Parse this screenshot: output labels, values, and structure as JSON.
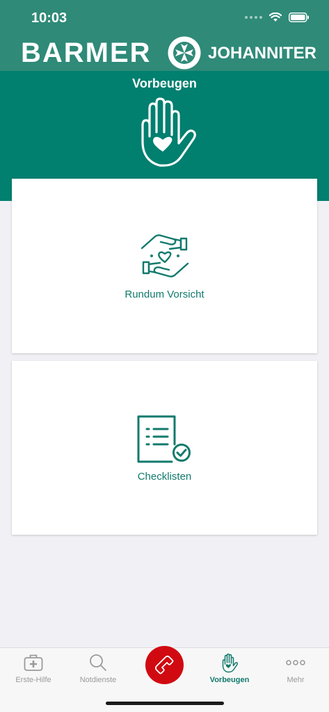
{
  "status_bar": {
    "time": "10:03"
  },
  "header": {
    "brand_left": "BARMER",
    "brand_right": "JOHANNITER",
    "emblem": "johanniter-cross-emblem",
    "page_title": "Vorbeugen",
    "hero_icon": "raised-hand-heart-icon"
  },
  "cards": [
    {
      "label": "Rundum Vorsicht",
      "icon": "hands-heart-icon"
    },
    {
      "label": "Checklisten",
      "icon": "checklist-icon"
    }
  ],
  "tabbar": {
    "items": [
      {
        "label": "Erste-Hilfe",
        "icon": "first-aid-kit-icon"
      },
      {
        "label": "Notdienste",
        "icon": "search-icon"
      },
      {
        "label": "",
        "icon": "phone-icon"
      },
      {
        "label": "Vorbeugen",
        "icon": "raised-hand-heart-icon",
        "active": true
      },
      {
        "label": "Mehr",
        "icon": "more-dots-icon"
      }
    ]
  },
  "colors": {
    "header_top": "#2f8a78",
    "header_main": "#017f6f",
    "accent_text": "#117a6c",
    "call_button": "#d10a11",
    "background": "#f1f1f5"
  }
}
